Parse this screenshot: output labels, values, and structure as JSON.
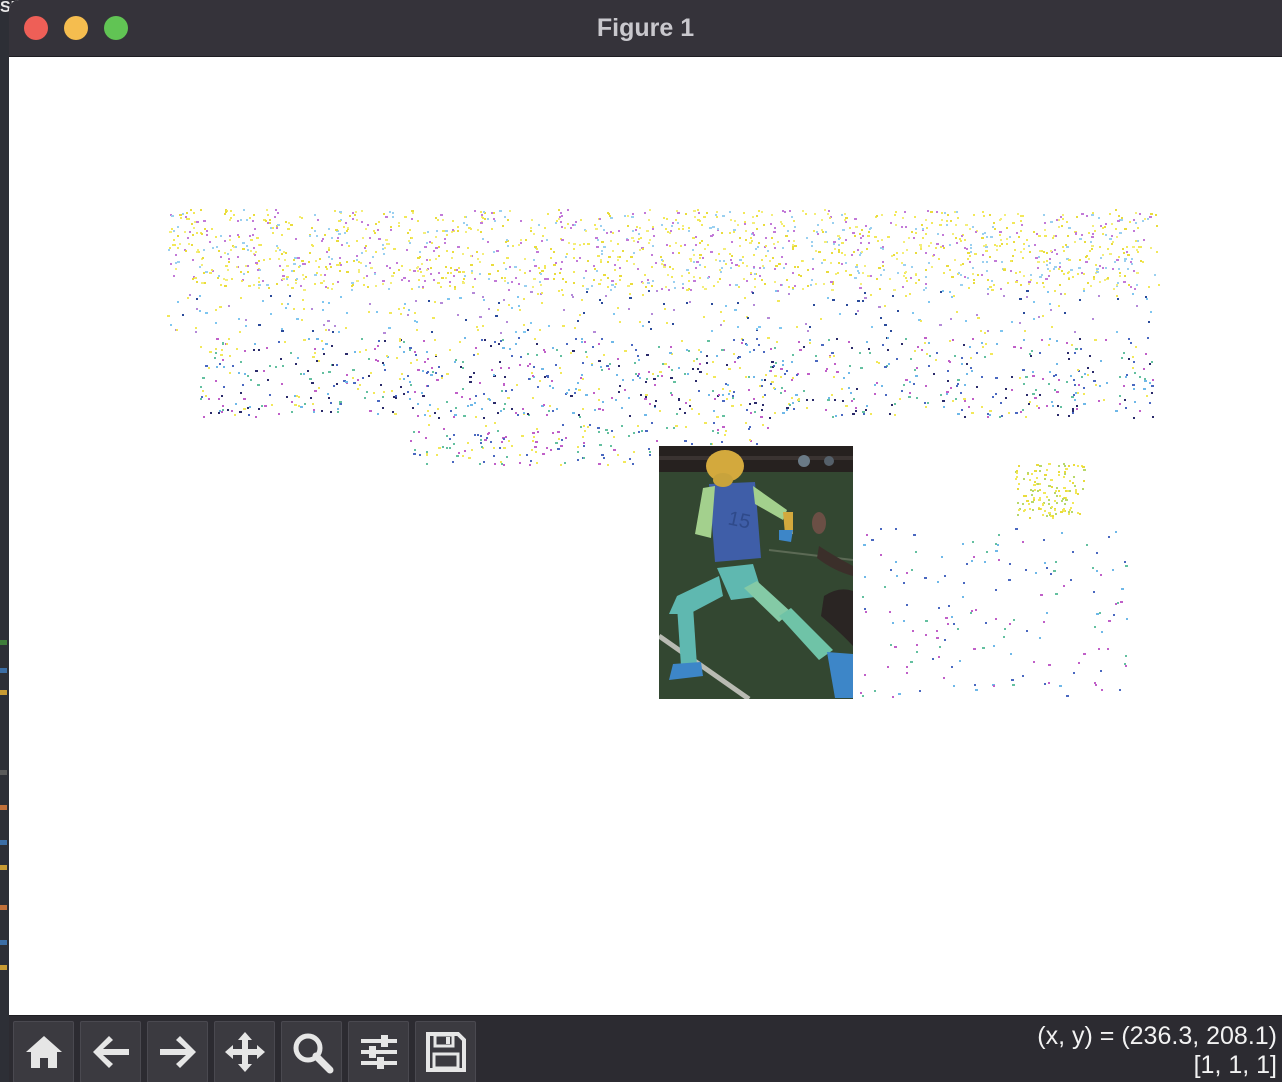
{
  "window": {
    "title": "Figure 1"
  },
  "toolbar": {
    "buttons": [
      {
        "icon": "home-icon"
      },
      {
        "icon": "back-arrow-icon"
      },
      {
        "icon": "forward-arrow-icon"
      },
      {
        "icon": "pan-move-icon"
      },
      {
        "icon": "zoom-magnifier-icon"
      },
      {
        "icon": "subplots-config-icon"
      },
      {
        "icon": "save-floppy-icon"
      }
    ],
    "coords": "(x, y) = (236.3, 208.1)",
    "pixel_value": "[1, 1, 1]"
  },
  "desktop": {
    "corner_text": "SI"
  },
  "colors": {
    "titlebar": "#35333a",
    "toolbar": "#2c2b31",
    "close": "#ee5f57",
    "minimize": "#f5bd4f",
    "maximize": "#61c454",
    "overlay_hair": "#d3a93d",
    "overlay_torso": "#3f5ea8",
    "overlay_arms": "#a3d08d",
    "overlay_legs": "#5fb8b0"
  }
}
